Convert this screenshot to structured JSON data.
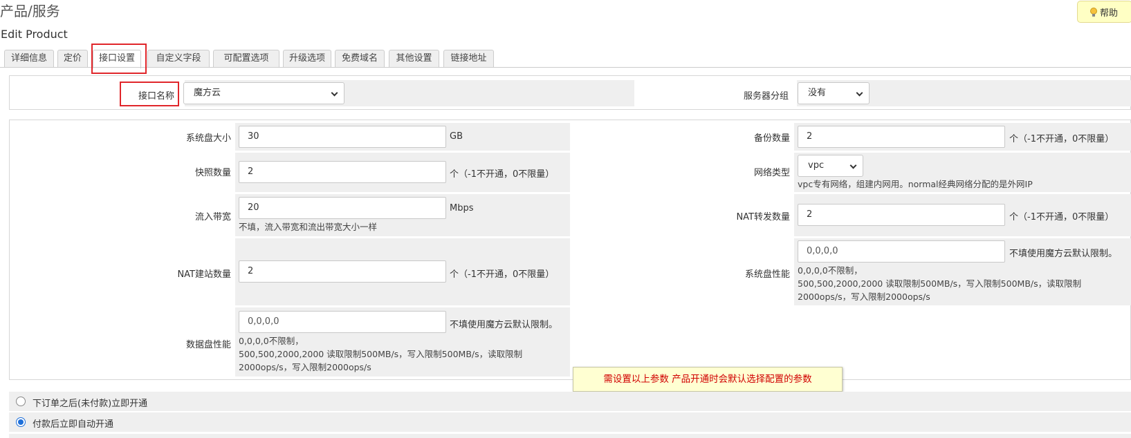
{
  "header": {
    "page_title": "产品/服务",
    "help_label": "帮助",
    "subtitle": "Edit Product"
  },
  "tabs": [
    {
      "label": "详细信息"
    },
    {
      "label": "定价"
    },
    {
      "label": "接口设置",
      "active": true
    },
    {
      "label": "自定义字段"
    },
    {
      "label": "可配置选项"
    },
    {
      "label": "升级选项"
    },
    {
      "label": "免费域名"
    },
    {
      "label": "其他设置"
    },
    {
      "label": "链接地址"
    }
  ],
  "module": {
    "name_label": "接口名称",
    "name_value": "魔方云",
    "server_group_label": "服务器分组",
    "server_group_value": "没有"
  },
  "fields": {
    "system_disk": {
      "label": "系统盘大小",
      "value": "30",
      "unit": "GB"
    },
    "backup_count": {
      "label": "备份数量",
      "value": "2",
      "unit": "个（-1不开通，0不限量）"
    },
    "snapshot_count": {
      "label": "快照数量",
      "value": "2",
      "unit": "个（-1不开通，0不限量）"
    },
    "network_type": {
      "label": "网络类型",
      "value": "vpc",
      "help": "vpc专有网络，组建内网用。normal经典网络分配的是外网IP"
    },
    "inbound_bandwidth": {
      "label": "流入带宽",
      "value": "20",
      "unit": "Mbps",
      "help": "不填，流入带宽和流出带宽大小一样"
    },
    "nat_forward_count": {
      "label": "NAT转发数量",
      "value": "2",
      "unit": "个（-1不开通，0不限量）"
    },
    "nat_site_count": {
      "label": "NAT建站数量",
      "value": "2",
      "unit": "个（-1不开通，0不限量）"
    },
    "system_disk_perf": {
      "label": "系统盘性能",
      "placeholder": "0,0,0,0",
      "unit": "不填使用魔方云默认限制。",
      "help1": "0,0,0,0不限制，",
      "help2": "500,500,2000,2000 读取限制500MB/s，写入限制500MB/s，读取限制",
      "help3": "2000ops/s，写入限制2000ops/s"
    },
    "data_disk_perf": {
      "label": "数据盘性能",
      "placeholder": "0,0,0,0",
      "unit": "不填使用魔方云默认限制。",
      "help1": "0,0,0,0不限制，",
      "help2": "500,500,2000,2000 读取限制500MB/s，写入限制500MB/s，读取限制",
      "help3": "2000ops/s，写入限制2000ops/s"
    }
  },
  "tooltip": "需设置以上参数 产品开通时会默认选择配置的参数",
  "activation": [
    {
      "label": "下订单之后(未付款)立即开通",
      "checked": false
    },
    {
      "label": "付款后立即自动开通",
      "checked": true
    }
  ],
  "colors": {
    "highlight": "#e0252a",
    "tooltip_text": "#d10000",
    "tooltip_bg": "#ffffd2",
    "radio_checked": "#1e6fd9",
    "help_bg": "#ffffc4"
  }
}
